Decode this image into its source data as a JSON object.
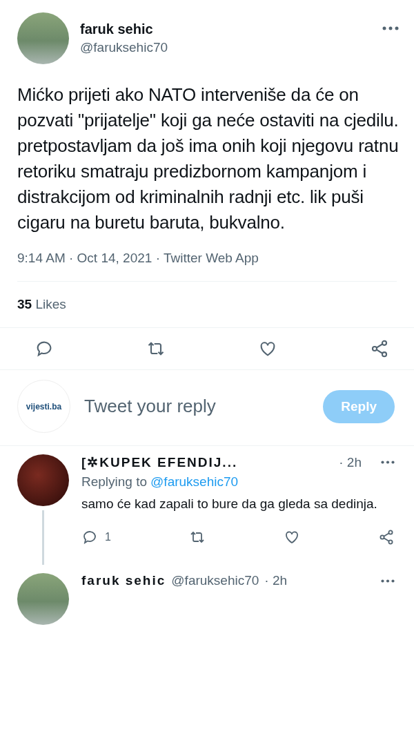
{
  "tweet": {
    "name": "faruk sehic",
    "handle": "@faruksehic70",
    "text": "Mićko prijeti ako NATO interveniše da će on pozvati \"prijatelje\" koji ga neće ostaviti na cjedilu. pretpostavljam da još ima onih koji njegovu ratnu retoriku smatraju predizbornom kampanjom i distrakcijom od kriminalnih radnji etc. lik puši cigaru na buretu baruta, bukvalno.",
    "meta": "9:14 AM · Oct 14, 2021 · Twitter Web App",
    "likes_count": "35",
    "likes_label": "Likes"
  },
  "composer": {
    "avatar_text": "vijesti.ba",
    "placeholder": "Tweet your reply",
    "button": "Reply",
    "disabled": true
  },
  "replies": [
    {
      "name": "[✲KUPEK EFENDIJ...",
      "time": "· 2h",
      "replying_label": "Replying to",
      "replying_handle": "@faruksehic70",
      "text": "samo će kad zapali to bure da ga gleda sa dedinja.",
      "reply_count": "1"
    },
    {
      "name": "faruk sehic",
      "handle": "@faruksehic70",
      "time": "· 2h"
    }
  ]
}
